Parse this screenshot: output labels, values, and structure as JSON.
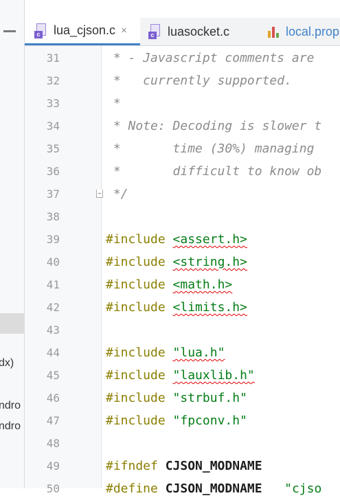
{
  "tabs": [
    {
      "label": "lua_cjson.c",
      "icon": "c-file-icon",
      "active": true,
      "close": "×"
    },
    {
      "label": "luasocket.c",
      "icon": "c-file-icon",
      "active": false
    },
    {
      "label": "local.prop",
      "icon": "properties-file-icon",
      "active": false
    }
  ],
  "left_panel": {
    "fragments": [
      "dx)",
      "ndro",
      "ndro"
    ]
  },
  "colors": {
    "comment": "#8c8c8c",
    "directive": "#8b7f00",
    "string": "#067d17",
    "symbol": "#1c1c1c",
    "accent": "#4083c9",
    "error": "#e00000"
  },
  "lines": [
    {
      "n": "31",
      "parts": [
        {
          "t": " * - Javascript comments are",
          "c": "cm"
        }
      ]
    },
    {
      "n": "32",
      "parts": [
        {
          "t": " *   currently supported.",
          "c": "cm"
        }
      ]
    },
    {
      "n": "33",
      "parts": [
        {
          "t": " *",
          "c": "cm"
        }
      ]
    },
    {
      "n": "34",
      "parts": [
        {
          "t": " * Note: Decoding is slower t",
          "c": "cm"
        }
      ]
    },
    {
      "n": "35",
      "parts": [
        {
          "t": " *       time (30%) managing",
          "c": "cm"
        }
      ]
    },
    {
      "n": "36",
      "parts": [
        {
          "t": " *       difficult to know ob",
          "c": "cm"
        }
      ]
    },
    {
      "n": "37",
      "parts": [
        {
          "t": " */",
          "c": "cm"
        }
      ]
    },
    {
      "n": "38",
      "parts": []
    },
    {
      "n": "39",
      "parts": [
        {
          "t": "#include ",
          "c": "dir"
        },
        {
          "t": "<assert.h>",
          "c": "pth",
          "sq": true
        }
      ]
    },
    {
      "n": "40",
      "parts": [
        {
          "t": "#include ",
          "c": "dir"
        },
        {
          "t": "<string.h>",
          "c": "pth",
          "sq": true
        }
      ]
    },
    {
      "n": "41",
      "parts": [
        {
          "t": "#include ",
          "c": "dir"
        },
        {
          "t": "<math.h>",
          "c": "pth",
          "sq": true
        }
      ]
    },
    {
      "n": "42",
      "parts": [
        {
          "t": "#include ",
          "c": "dir"
        },
        {
          "t": "<limits.h>",
          "c": "pth",
          "sq": true
        }
      ]
    },
    {
      "n": "43",
      "parts": []
    },
    {
      "n": "44",
      "parts": [
        {
          "t": "#include ",
          "c": "dir"
        },
        {
          "t": "\"lua.h\"",
          "c": "pth",
          "sq": true
        }
      ]
    },
    {
      "n": "45",
      "parts": [
        {
          "t": "#include ",
          "c": "dir"
        },
        {
          "t": "\"lauxlib.h\"",
          "c": "pth",
          "sq": true
        }
      ]
    },
    {
      "n": "46",
      "parts": [
        {
          "t": "#include ",
          "c": "dir"
        },
        {
          "t": "\"strbuf.h\"",
          "c": "pth"
        }
      ]
    },
    {
      "n": "47",
      "parts": [
        {
          "t": "#include ",
          "c": "dir"
        },
        {
          "t": "\"fpconv.h\"",
          "c": "pth"
        }
      ]
    },
    {
      "n": "48",
      "parts": []
    },
    {
      "n": "49",
      "parts": [
        {
          "t": "#ifndef ",
          "c": "dir"
        },
        {
          "t": "CJSON_MODNAME",
          "c": "sym"
        }
      ]
    },
    {
      "n": "50",
      "parts": [
        {
          "t": "#define ",
          "c": "dir"
        },
        {
          "t": "CJSON_MODNAME",
          "c": "sym"
        },
        {
          "t": "   \"cjso",
          "c": "pth"
        }
      ]
    }
  ]
}
